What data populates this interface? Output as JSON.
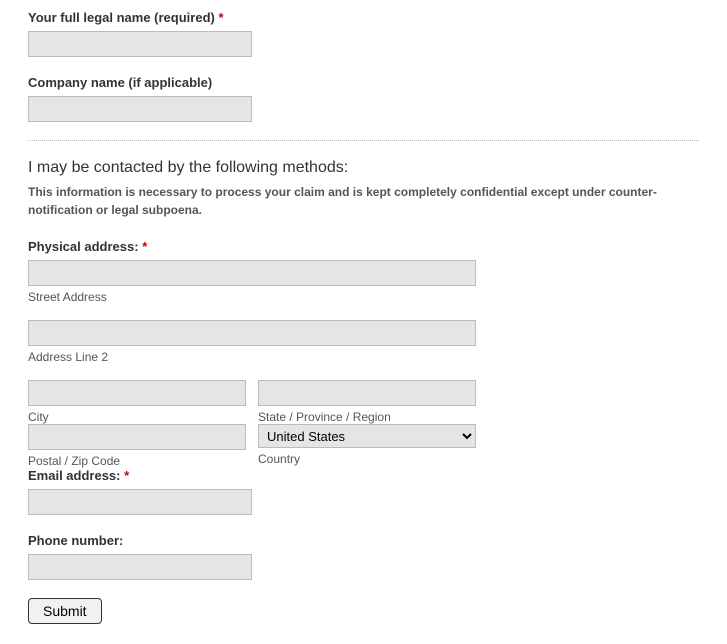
{
  "fields": {
    "full_name_label": "Your full legal name (required)",
    "company_label": "Company name (if applicable)",
    "physical_address_label": "Physical address:",
    "email_label": "Email address:",
    "phone_label": "Phone number:"
  },
  "required_marker": "*",
  "section": {
    "heading": "I may be contacted by the following methods:",
    "note": "This information is necessary to process your claim and is kept completely confidential except under counter-notification or legal subpoena."
  },
  "address": {
    "street_sub": "Street Address",
    "line2_sub": "Address Line 2",
    "city_sub": "City",
    "state_sub": "State / Province / Region",
    "postal_sub": "Postal / Zip Code",
    "country_sub": "Country",
    "country_selected": "United States"
  },
  "submit_label": "Submit"
}
